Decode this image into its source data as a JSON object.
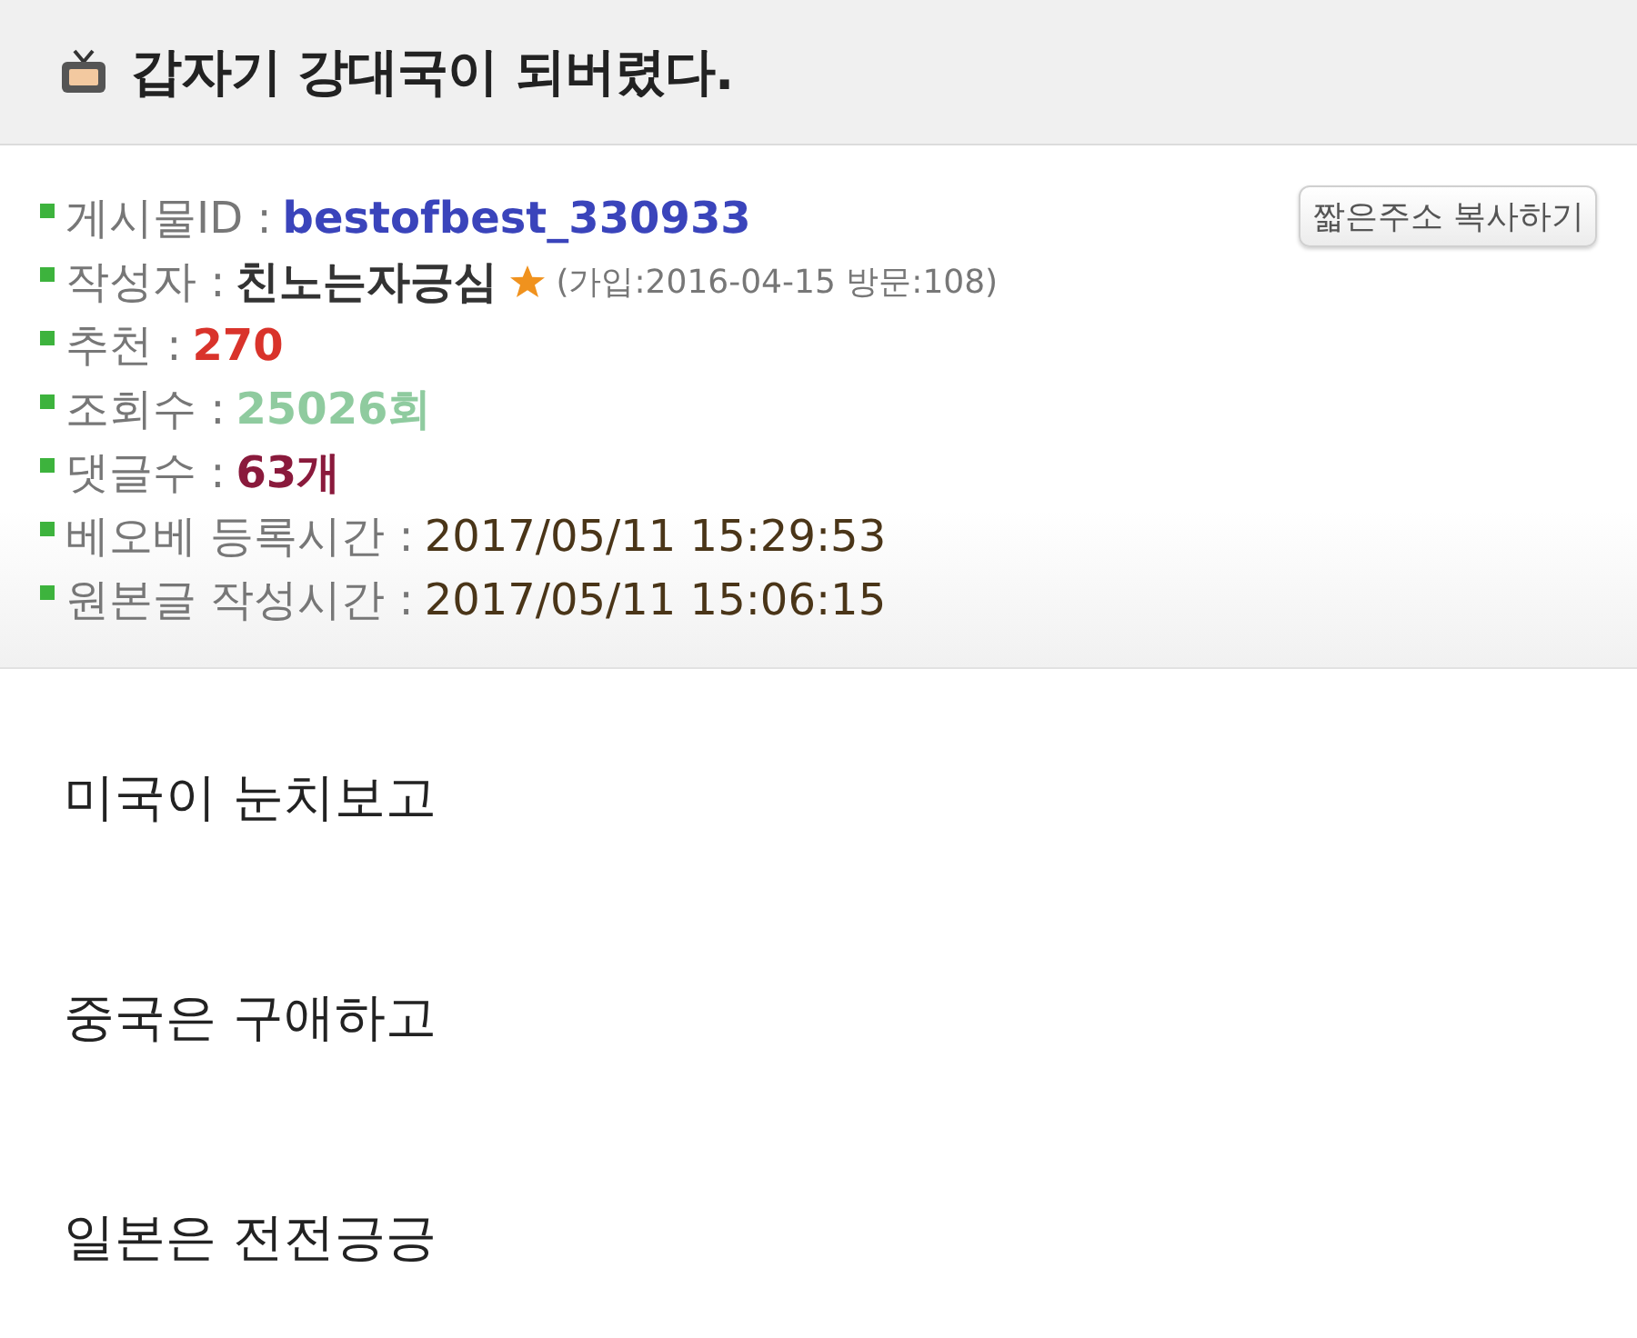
{
  "title": "갑자기 강대국이 되버렸다.",
  "info": {
    "copy_button": "짧은주소 복사하기",
    "rows": [
      {
        "label": "게시물ID :",
        "value": "bestofbest_330933",
        "color": "#3a44bb"
      },
      {
        "label": "작성자 :",
        "value": "친노는자긍심",
        "color": "#333333",
        "starred": true,
        "note": "(가입:2016-04-15 방문:108)"
      },
      {
        "label": "추천 :",
        "value": "270",
        "color": "#d9332b"
      },
      {
        "label": "조회수 :",
        "value": "25026회",
        "color": "#8fcb9f"
      },
      {
        "label": "댓글수 :",
        "value": "63개",
        "color": "#8a1a3c"
      },
      {
        "label": "베오베 등록시간 :",
        "value": "2017/05/11 15:29:53",
        "color": "#4a3518"
      },
      {
        "label": "원본글 작성시간 :",
        "value": "2017/05/11 15:06:15",
        "color": "#4a3518"
      }
    ]
  },
  "body": [
    "미국이 눈치보고",
    "중국은 구애하고",
    "일본은 전전긍긍"
  ]
}
